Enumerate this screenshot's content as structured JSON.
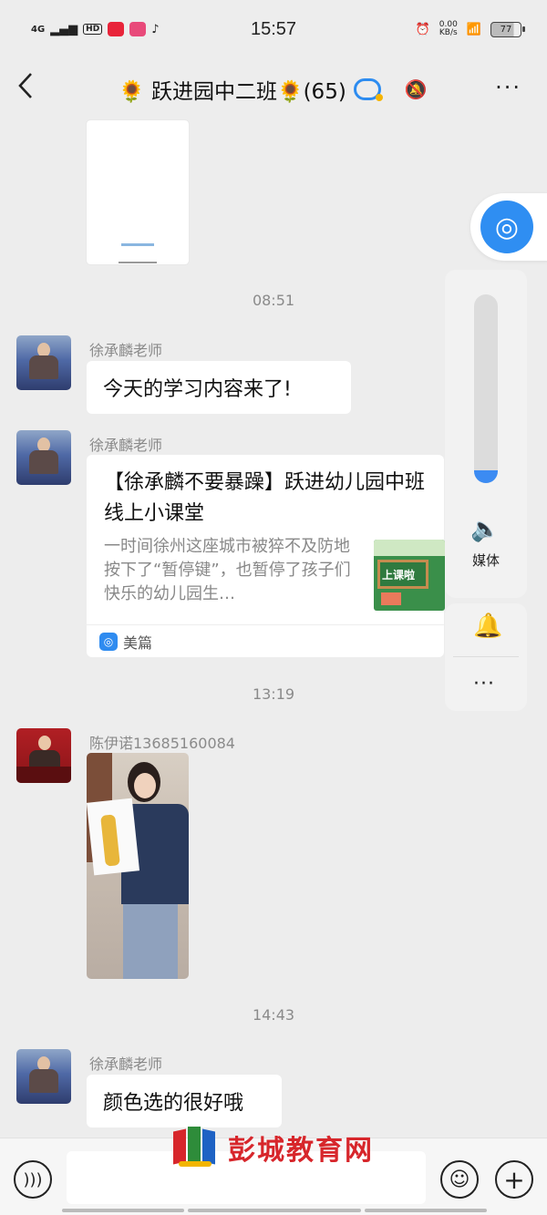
{
  "status_bar": {
    "network": "4G",
    "hd": "HD",
    "time": "15:57",
    "speed_value": "0.00",
    "speed_unit": "KB/s",
    "battery": "77"
  },
  "header": {
    "back_icon": "chevron-left-icon",
    "title": "🌻 跃进园中二班🌻(65)",
    "more_label": "···"
  },
  "messages": {
    "time1": "08:51",
    "m1": {
      "sender": "徐承麟老师",
      "text": "今天的学习内容来了!"
    },
    "m2": {
      "sender": "徐承麟老师",
      "card_title": "【徐承麟不要暴躁】跃进幼儿园中班线上小课堂",
      "card_desc": "一时间徐州这座城市被猝不及防地按下了“暂停键”，也暂停了孩子们快乐的幼儿园生…",
      "card_thumb_text": "上课啦",
      "card_source": "美篇"
    },
    "time2": "13:19",
    "m3": {
      "sender": "陈伊诺13685160084"
    },
    "time3": "14:43",
    "m4": {
      "sender": "徐承麟老师",
      "text": "颜色选的很好哦"
    }
  },
  "side_panel": {
    "volume_level": 0.07,
    "media_label": "媒体",
    "volume_icon": "speaker-icon",
    "bell_icon": "bell-icon",
    "more_icon": "more-dots-icon"
  },
  "bottom": {
    "voice_icon": "voice-icon",
    "emoji_icon": "emoji-icon",
    "plus_icon": "plus-icon"
  },
  "watermark": {
    "text": "彭城教育网"
  },
  "colors": {
    "accent": "#2f8ef2",
    "background": "#ededed",
    "watermark": "#d7262b"
  }
}
